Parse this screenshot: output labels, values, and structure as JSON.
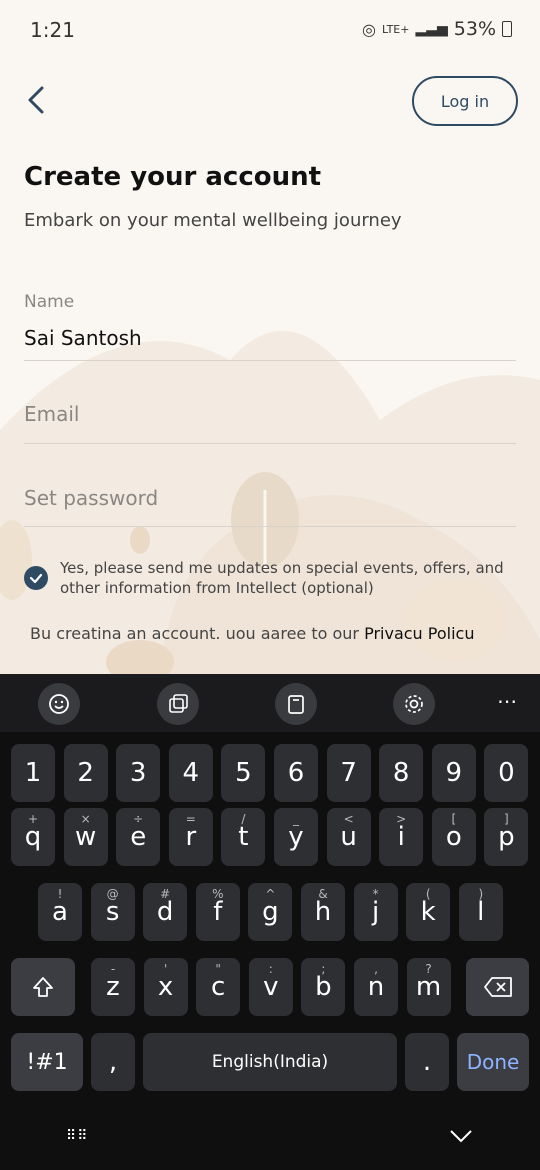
{
  "status_bar": {
    "time": "1:21",
    "battery": "53%",
    "network": "LTE+"
  },
  "header": {
    "login_label": "Log in"
  },
  "page": {
    "title": "Create your account",
    "subtitle": "Embark on your mental wellbeing journey"
  },
  "form": {
    "name_label": "Name",
    "name_value": "Sai Santosh",
    "email_placeholder": "Email",
    "password_placeholder": "Set password",
    "consent_text": "Yes, please send me updates on special events, offers, and other information from Intellect (optional)",
    "consent_checked": true
  },
  "terms": {
    "prefix": "Bu creatina an account. uou aaree to our ",
    "link": "Privacu Policu"
  },
  "keyboard": {
    "number_row": [
      "1",
      "2",
      "3",
      "4",
      "5",
      "6",
      "7",
      "8",
      "9",
      "0"
    ],
    "row1": [
      {
        "k": "q",
        "s": "+"
      },
      {
        "k": "w",
        "s": "×"
      },
      {
        "k": "e",
        "s": "÷"
      },
      {
        "k": "r",
        "s": "="
      },
      {
        "k": "t",
        "s": "/"
      },
      {
        "k": "y",
        "s": "_"
      },
      {
        "k": "u",
        "s": "<"
      },
      {
        "k": "i",
        "s": ">"
      },
      {
        "k": "o",
        "s": "["
      },
      {
        "k": "p",
        "s": "]"
      }
    ],
    "row2": [
      {
        "k": "a",
        "s": "!"
      },
      {
        "k": "s",
        "s": "@"
      },
      {
        "k": "d",
        "s": "#"
      },
      {
        "k": "f",
        "s": "%"
      },
      {
        "k": "g",
        "s": "^"
      },
      {
        "k": "h",
        "s": "&"
      },
      {
        "k": "j",
        "s": "*"
      },
      {
        "k": "k",
        "s": "("
      },
      {
        "k": "l",
        "s": ")"
      }
    ],
    "row3": [
      {
        "k": "z",
        "s": "-"
      },
      {
        "k": "x",
        "s": "'"
      },
      {
        "k": "c",
        "s": "\""
      },
      {
        "k": "v",
        "s": ":"
      },
      {
        "k": "b",
        "s": ";"
      },
      {
        "k": "n",
        "s": ","
      },
      {
        "k": "m",
        "s": "?"
      }
    ],
    "symbols_key": "!#1",
    "comma_key": ",",
    "space_label": "English(India)",
    "period_key": ".",
    "done_label": "Done"
  },
  "colors": {
    "accent": "#2f4a63",
    "background": "#faf7f2",
    "keyboard_bg": "#0f0f10",
    "key_bg": "#2e2f33",
    "done_text": "#8fb4ff"
  }
}
